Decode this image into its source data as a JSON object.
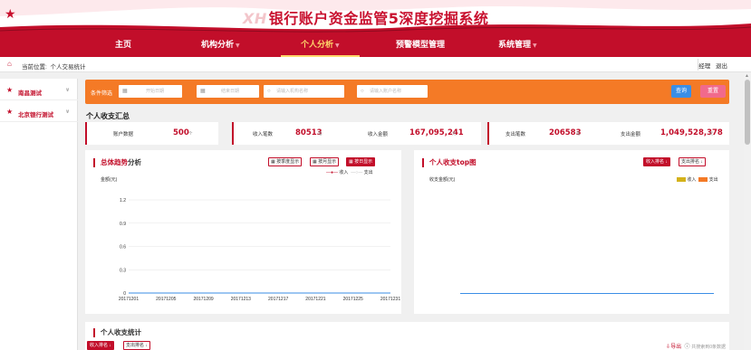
{
  "header": {
    "title_prefix": "XH",
    "title": "银行账户资金监管5深度挖掘系统"
  },
  "nav": {
    "items": [
      {
        "label": "主页",
        "caret": ""
      },
      {
        "label": "机构分析",
        "caret": "▼"
      },
      {
        "label": "个人分析",
        "caret": "▼"
      },
      {
        "label": "预警模型管理",
        "caret": ""
      },
      {
        "label": "系统管理",
        "caret": "▼"
      }
    ]
  },
  "breadcrumb": {
    "prefix": "当前位置:",
    "page": "个人交易统计",
    "user": "经理",
    "logout": "退出"
  },
  "sidebar": {
    "items": [
      {
        "label": "南昌测试"
      },
      {
        "label": "北京银行测试"
      }
    ]
  },
  "filter": {
    "label": "条件筛选",
    "start_placeholder": "开始日期",
    "to": "至",
    "end_placeholder": "结束日期",
    "org_placeholder": "请输入机构名称",
    "account_placeholder": "请输入账户名称",
    "query": "查询",
    "reset": "重置"
  },
  "summary": {
    "title": "个人收支汇总",
    "boxes": [
      {
        "key": "账户数据",
        "value": "500",
        "unit": "个"
      },
      {
        "key": "收入笔数",
        "value": "80513",
        "unit": "笔"
      },
      {
        "key": "收入金额",
        "value": "167,095,241",
        "unit": "元"
      },
      {
        "key": "支出笔数",
        "value": "206583",
        "unit": "笔"
      },
      {
        "key": "支出金额",
        "value": "1,049,528,378",
        "unit": "元"
      }
    ]
  },
  "trend": {
    "title_red": "总体趋势",
    "title_dark": "分析",
    "buttons": [
      "按季度显示",
      "按月显示",
      "按日显示"
    ],
    "active_index": 2,
    "ylabel": "金额(元)",
    "legend": [
      "收入",
      "支出"
    ]
  },
  "top": {
    "title": "个人收支top图",
    "buttons": [
      "收入排名 ↓",
      "支出排名 ↓"
    ],
    "ylabel": "收支金额(元)",
    "legend": [
      "收入",
      "支出"
    ]
  },
  "stats": {
    "title": "个人收支统计",
    "buttons": [
      "收入排名 ↓",
      "支出排名 ↓"
    ],
    "export": "导出",
    "count_text": "共搜索到0条数据"
  },
  "colors": {
    "brand": "#c20e2a",
    "filter": "#f47a26",
    "income": "#d4b21a",
    "expense": "#f47a26",
    "line": "#3a8ee6"
  },
  "chart_data": [
    {
      "type": "line",
      "x": [
        "20171201",
        "20171205",
        "20171209",
        "20171213",
        "20171217",
        "20171221",
        "20171225",
        "20171231"
      ],
      "series": [
        {
          "name": "收入",
          "values": [
            0,
            0,
            0,
            0,
            0,
            0,
            0,
            0
          ]
        },
        {
          "name": "支出",
          "values": [
            0,
            0,
            0,
            0,
            0,
            0,
            0,
            0
          ]
        }
      ],
      "ylabel": "金额(元)",
      "yticks": [
        "0",
        "0.3",
        "0.6",
        "0.9",
        "1.2"
      ],
      "ylim": [
        0,
        1.2
      ],
      "grid": true,
      "legend": "top-right"
    },
    {
      "type": "bar",
      "categories": [],
      "series": [
        {
          "name": "收入",
          "values": []
        },
        {
          "name": "支出",
          "values": []
        }
      ],
      "ylabel": "收支金额(元)",
      "legend": "top-right"
    }
  ]
}
